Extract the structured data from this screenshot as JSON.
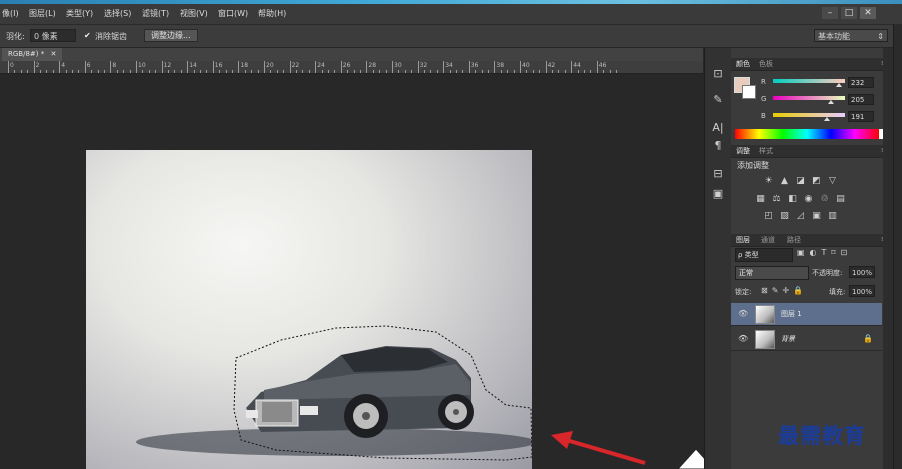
{
  "menu": {
    "items": [
      "像(I)",
      "图层(L)",
      "类型(Y)",
      "选择(S)",
      "滤镜(T)",
      "视图(V)",
      "窗口(W)",
      "帮助(H)"
    ],
    "window_buttons": [
      "–",
      "□",
      "✕"
    ]
  },
  "options": {
    "feather_label": "羽化:",
    "feather_value": "0 像素",
    "antialias_checked": true,
    "antialias_label": "消除锯齿",
    "refine_button": "调整边缘...",
    "workspace": "基本功能"
  },
  "document": {
    "tab_title": "RGB/8#) *",
    "ruler_ticks": [
      "0",
      "2",
      "4",
      "6",
      "8",
      "10",
      "12",
      "14",
      "16",
      "18",
      "20",
      "22",
      "24",
      "26",
      "28",
      "30",
      "32",
      "34",
      "36",
      "38",
      "40",
      "42",
      "44",
      "46"
    ]
  },
  "color_panel": {
    "tabs": [
      "颜色",
      "色板"
    ],
    "r_label": "R",
    "r_value": "232",
    "g_label": "G",
    "g_value": "205",
    "b_label": "B",
    "b_value": "191",
    "r": 232,
    "g": 205,
    "b": 191,
    "foreground": "#e8cdbf"
  },
  "adjust_panel": {
    "tabs": [
      "调整",
      "样式"
    ],
    "title": "添加调整"
  },
  "layers_panel": {
    "tabs": [
      "图层",
      "通道",
      "路径"
    ],
    "filter_label": "ρ 类型",
    "blend_mode": "正常",
    "opacity_label": "不透明度:",
    "opacity_value": "100%",
    "lock_label": "锁定:",
    "fill_label": "填充:",
    "fill_value": "100%",
    "layers": [
      {
        "name": "图层 1",
        "selected": true
      },
      {
        "name": "背景",
        "selected": false,
        "locked": true
      }
    ]
  },
  "watermark": "最需教育",
  "colors": {
    "selected_layer": "#5d6f8c",
    "watermark": "#1b3d99",
    "arrow": "#d9262b"
  }
}
